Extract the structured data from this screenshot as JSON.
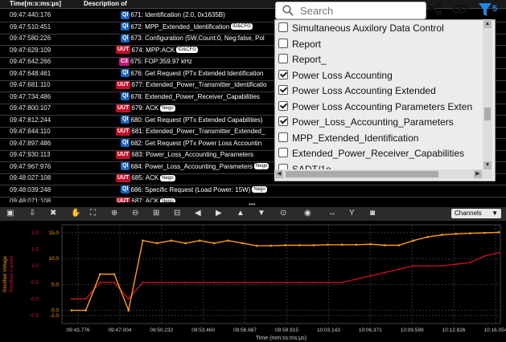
{
  "log": {
    "columns": [
      "Time[m:s:ms:µs]",
      "Description of"
    ],
    "rows": [
      {
        "time": "09:47:440:176",
        "badge": "QI",
        "text": "671: Identification (2.0, 0x1635B)",
        "tag": ""
      },
      {
        "time": "09:47:510:451",
        "badge": "QI",
        "text": "672: MPP_Extended_Identification",
        "tag": "ID&CFG"
      },
      {
        "time": "09:47:580:226",
        "badge": "QI",
        "text": "673: Configuration (5W,Count:0, Neg:false, Pol",
        "tag": ""
      },
      {
        "time": "09:47:629:109",
        "badge": "UUT",
        "text": "674: MPP:ACK",
        "tag": "ID&CFG"
      },
      {
        "time": "09:47:642:266",
        "badge": "C3",
        "text": "675: FOP:359.97 kHz",
        "tag": ""
      },
      {
        "time": "09:47:648:461",
        "badge": "QI",
        "text": "676: Get Request (PTx Extended Identification",
        "tag": ""
      },
      {
        "time": "09:47:681:110",
        "badge": "UUT",
        "text": "677: Extended_Power_Transmitter_Identificatio",
        "tag": ""
      },
      {
        "time": "09:47:734:486",
        "badge": "QI",
        "text": "678: Extended_Power_Receiver_Capabilities",
        "tag": ""
      },
      {
        "time": "09:47:800:107",
        "badge": "UUT",
        "text": "679: ACK",
        "tag": "Nego"
      },
      {
        "time": "09:47:812:244",
        "badge": "QI",
        "text": "680: Get Request (PTx Extended Capabilities)",
        "tag": ""
      },
      {
        "time": "09:47:844:110",
        "badge": "UUT",
        "text": "681: Extended_Power_Transmitter_Extended_",
        "tag": ""
      },
      {
        "time": "09:47:897:486",
        "badge": "QI",
        "text": "682: Get Request (PTx Power Loss Accountin",
        "tag": ""
      },
      {
        "time": "09:47:930:113",
        "badge": "UUT",
        "text": "683: Power_Loss_Accounting_Parameters",
        "tag": ""
      },
      {
        "time": "09:47:967:976",
        "badge": "QI",
        "text": "684: Power_Loss_Accounting_Parameters",
        "tag": "Nego"
      },
      {
        "time": "09:48:027:108",
        "badge": "UUT",
        "text": "685: ACK",
        "tag": "Nego"
      },
      {
        "time": "09:48:039:248",
        "badge": "QI",
        "text": "686: Specific Request (Load Power: 15W)",
        "tag": "Nego"
      },
      {
        "time": "09:48:071:108",
        "badge": "UUT",
        "text": "687: ACK",
        "tag": "Nego"
      }
    ]
  },
  "filter": {
    "search_placeholder": "Search",
    "filter_count": "5",
    "items": [
      {
        "label": "Simultaneous Auxilory Data Control",
        "checked": false
      },
      {
        "label": "Report",
        "checked": false
      },
      {
        "label": "Report_",
        "checked": false
      },
      {
        "label": "Power Loss Accounting",
        "checked": true
      },
      {
        "label": "Power Loss Accounting Extended",
        "checked": true
      },
      {
        "label": "Power Loss Accounting Parameters Exten",
        "checked": true
      },
      {
        "label": "Power_Loss_Accounting_Parameters",
        "checked": true
      },
      {
        "label": "MPP_Extended_Identification",
        "checked": false
      },
      {
        "label": "Extended_Power_Receiver_Capabilities",
        "checked": false
      },
      {
        "label": "SADT/1e",
        "checked": false
      }
    ]
  },
  "toolbar": {
    "channels_label": "Channels"
  },
  "chart_data": {
    "type": "line",
    "xlabel": "Time (mm:ss:ms:µs)",
    "x_ticks": [
      "09:43.776",
      "09:47.004",
      "09:50.232",
      "09:53.460",
      "09:56.687",
      "09:59.915",
      "10:03.143",
      "10:06.371",
      "10:09.599",
      "10:12.826",
      "10:16.054"
    ],
    "series": [
      {
        "name": "Rectified Voltage",
        "color": "#ff9a1e",
        "axis": "left-inner",
        "y_ticks": [
          "15.0",
          "10.0",
          "5.0",
          "0.0",
          "-1.0"
        ],
        "values": [
          0,
          0,
          7,
          7,
          0,
          13.5,
          13,
          13.5,
          13,
          13.5,
          13,
          13.5,
          13,
          12.5,
          12.5,
          12.6,
          12.6,
          12.6,
          12.7,
          12.7,
          12.7,
          12.8,
          12.6,
          12.6,
          13.5,
          14.2,
          14.6,
          14.8,
          14.9,
          15.0,
          15.1
        ]
      },
      {
        "name": "Rectified Current",
        "color": "#e0102a",
        "axis": "left-outer",
        "y_ticks": [
          "2.0",
          "1.5",
          "1.0",
          "0.5",
          "0.0",
          "-0.5"
        ],
        "values": [
          0,
          0,
          0.5,
          0.5,
          0,
          0.5,
          0.5,
          0.5,
          0.5,
          0.5,
          0.5,
          0.5,
          0.5,
          0.5,
          0.5,
          0.5,
          0.5,
          0.5,
          0.5,
          0.5,
          0.6,
          0.7,
          0.8,
          0.9,
          1.0,
          1.0,
          1.0,
          1.05,
          1.1,
          1.3,
          1.4
        ]
      }
    ]
  }
}
